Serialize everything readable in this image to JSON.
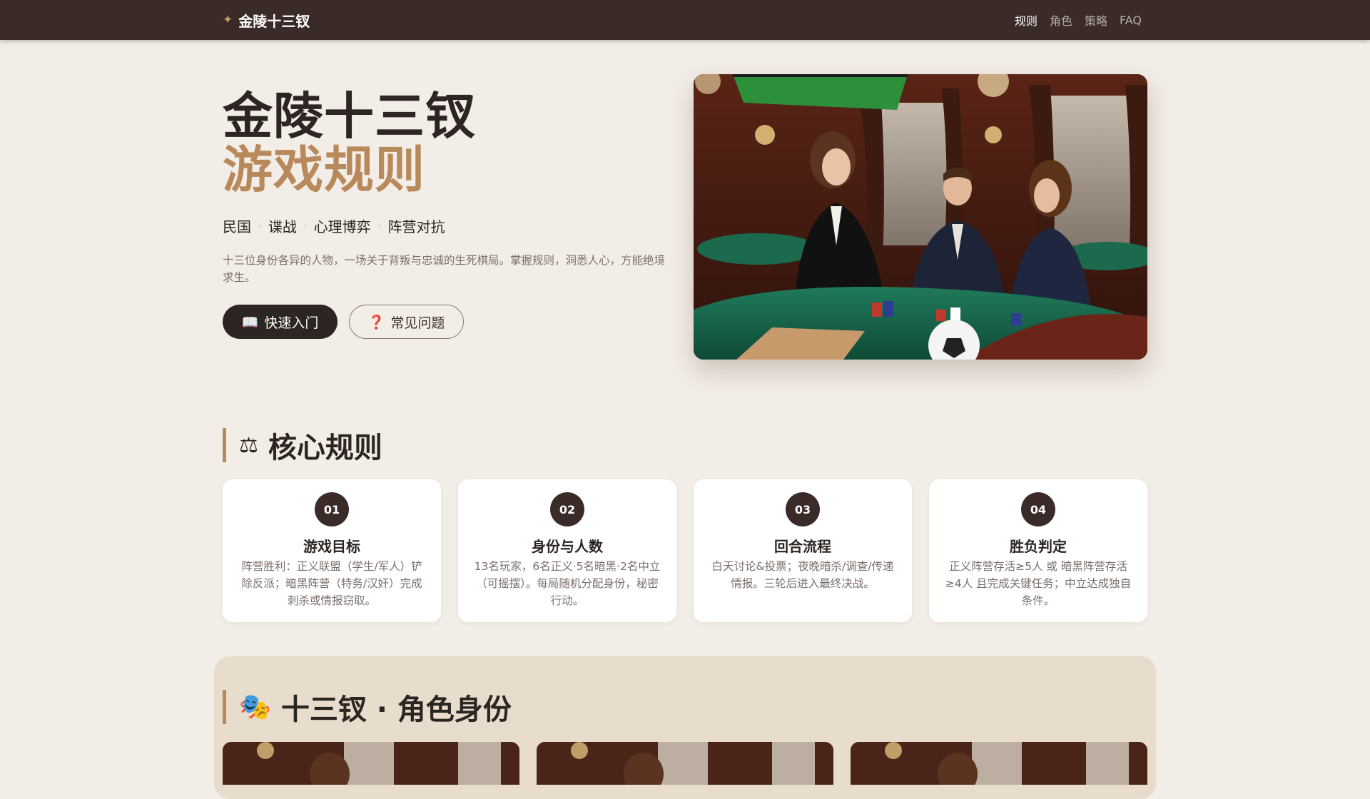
{
  "nav": {
    "brand_icon": "sparkle-icon",
    "brand": "金陵十三钗",
    "links": [
      "规则",
      "角色",
      "策略",
      "FAQ"
    ],
    "active": "规则"
  },
  "hero": {
    "title": "金陵十三钗",
    "subtitle": "游戏规则",
    "tags": [
      "民国",
      "谍战",
      "心理博弈",
      "阵营对抗"
    ],
    "description": "十三位身份各异的人物，一场关于背叛与忠诚的生死棋局。掌握规则，洞悉人心，方能绝境求生。",
    "primary_button": "快速入门",
    "primary_icon": "📖",
    "secondary_button": "常见问题",
    "secondary_icon": "❓"
  },
  "rules": {
    "icon": "⚖",
    "title": "核心规则",
    "cards": [
      {
        "num": "01",
        "title": "游戏目标",
        "text": "阵营胜利：正义联盟（学生/军人）铲除反派；暗黑阵营（特务/汉奸）完成刺杀或情报窃取。"
      },
      {
        "num": "02",
        "title": "身份与人数",
        "text": "13名玩家，6名正义·5名暗黑·2名中立（可摇摆）。每局随机分配身份，秘密行动。"
      },
      {
        "num": "03",
        "title": "回合流程",
        "text": "白天讨论&投票；夜晚暗杀/调查/传递情报。三轮后进入最终决战。"
      },
      {
        "num": "04",
        "title": "胜负判定",
        "text": "正义阵营存活≥5人 或 暗黑阵营存活≥4人 且完成关键任务；中立达成独自条件。"
      }
    ]
  },
  "roles": {
    "icon": "🎭",
    "title": "十三钗 · 角色身份"
  },
  "colors": {
    "nav_bg": "#3a2b28",
    "page_bg": "#f3ede7",
    "accent": "#b8895b",
    "panel_bg": "#e8dccd"
  }
}
